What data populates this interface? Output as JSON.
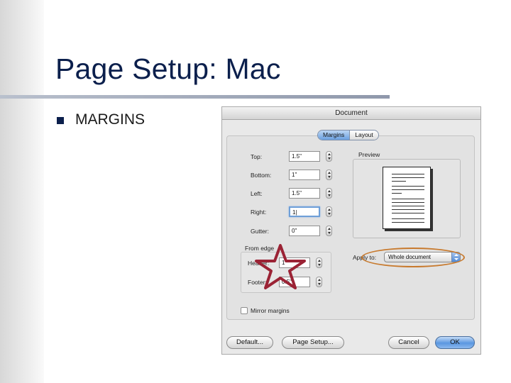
{
  "slide": {
    "title": "Page Setup: Mac",
    "bullet": "MARGINS"
  },
  "dialog": {
    "title": "Document",
    "tabs": [
      {
        "label": "Margins",
        "active": true
      },
      {
        "label": "Layout",
        "active": false
      }
    ],
    "fields": {
      "top": {
        "label": "Top:",
        "value": "1.5\""
      },
      "bottom": {
        "label": "Bottom:",
        "value": "1\""
      },
      "left": {
        "label": "Left:",
        "value": "1.5\""
      },
      "right": {
        "label": "Right:",
        "value": "1|"
      },
      "gutter": {
        "label": "Gutter:",
        "value": "0\""
      }
    },
    "from_edge": {
      "label": "From edge",
      "header": {
        "label": "Header:",
        "value": "1\""
      },
      "footer": {
        "label": "Footer:",
        "value": "0.5\""
      }
    },
    "preview_label": "Preview",
    "apply_to": {
      "label": "Apply to:",
      "value": "Whole document"
    },
    "mirror_margins": {
      "label": "Mirror margins",
      "checked": false
    },
    "buttons": {
      "default": "Default...",
      "page_setup": "Page Setup...",
      "cancel": "Cancel",
      "ok": "OK"
    }
  },
  "annotations": {
    "star_color": "#9b2335",
    "ellipse_color": "#c87a2e"
  }
}
